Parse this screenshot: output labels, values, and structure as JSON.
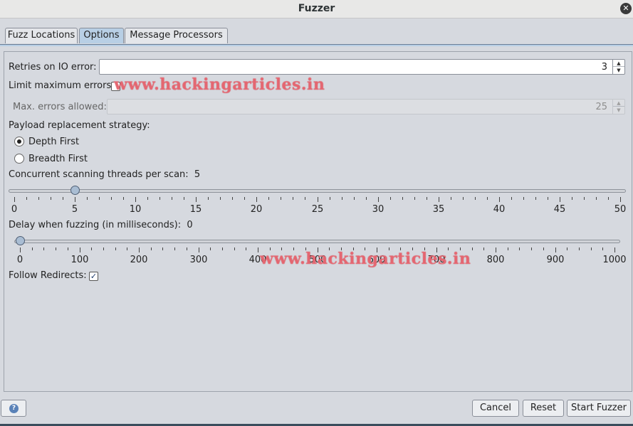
{
  "window": {
    "title": "Fuzzer",
    "close_icon": "✕"
  },
  "tabs": [
    {
      "label": "Fuzz Locations",
      "active": false
    },
    {
      "label": "Options",
      "active": true
    },
    {
      "label": "Message Processors",
      "active": false
    }
  ],
  "options": {
    "retries_label": "Retries on IO error:",
    "retries_value": "3",
    "limit_errors_label": "Limit maximum errors:",
    "limit_errors_checked": false,
    "max_errors_label": "Max. errors allowed:",
    "max_errors_value": "25",
    "strategy_label": "Payload replacement strategy:",
    "strategy_options": [
      {
        "label": "Depth First",
        "selected": true
      },
      {
        "label": "Breadth First",
        "selected": false
      }
    ],
    "threads_label": "Concurrent scanning threads per scan:",
    "threads_value": "5",
    "threads_slider": {
      "min": 0,
      "max": 50,
      "value": 5,
      "labels": [
        "0",
        "5",
        "10",
        "15",
        "20",
        "25",
        "30",
        "35",
        "40",
        "45",
        "50"
      ]
    },
    "delay_label": "Delay when fuzzing (in milliseconds):",
    "delay_value": "0",
    "delay_slider": {
      "min": 0,
      "max": 1000,
      "value": 0,
      "labels": [
        "0",
        "100",
        "200",
        "300",
        "400",
        "500",
        "600",
        "700",
        "800",
        "900",
        "1000"
      ]
    },
    "follow_redirects_label": "Follow Redirects:",
    "follow_redirects_checked": true
  },
  "watermark_text": "www.hackingarticles.in",
  "footer": {
    "help_icon": "?",
    "cancel_label": "Cancel",
    "reset_label": "Reset",
    "start_label": "Start Fuzzer"
  },
  "colors": {
    "active_tab": "#b8cfe5",
    "slider_thumb": "#a9bdd3",
    "watermark": "#e8707b"
  }
}
